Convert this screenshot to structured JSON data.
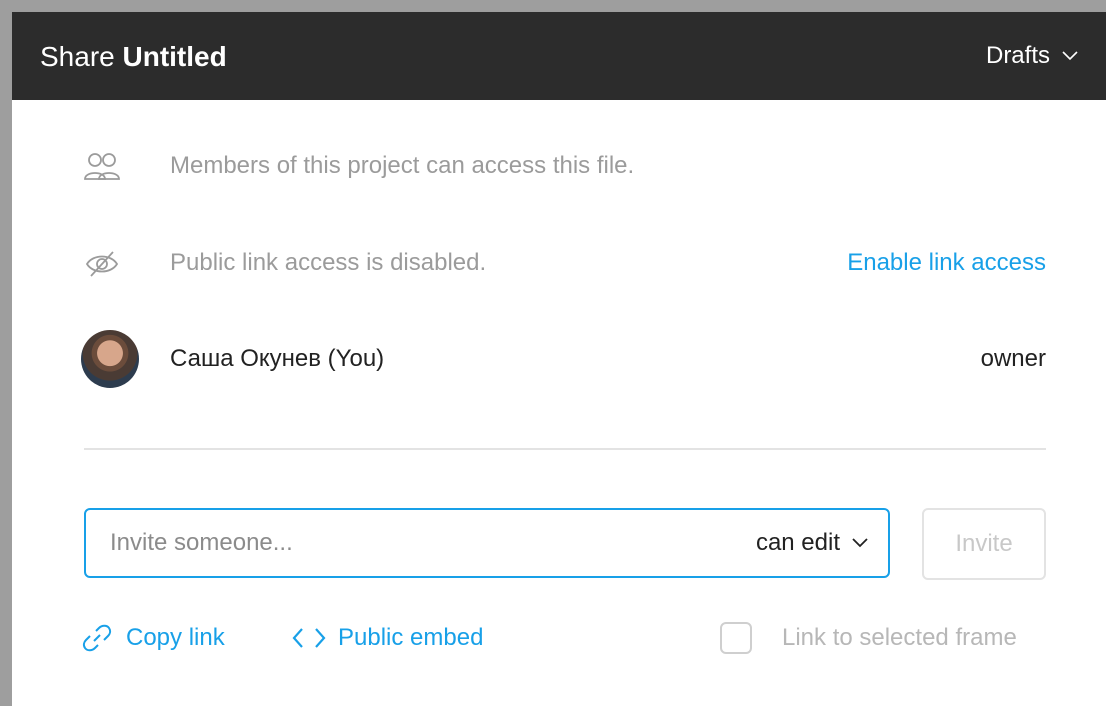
{
  "header": {
    "title_prefix": "Share",
    "file_name": "Untitled",
    "project": "Drafts"
  },
  "info": {
    "members_text": "Members of this project can access this file.",
    "link_status_text": "Public link access is disabled.",
    "enable_link_label": "Enable link access"
  },
  "member": {
    "name": "Саша Окунев (You)",
    "role": "owner"
  },
  "invite": {
    "placeholder": "Invite someone...",
    "permission": "can edit",
    "button_label": "Invite"
  },
  "footer": {
    "copy_link_label": "Copy link",
    "public_embed_label": "Public embed",
    "link_to_frame_label": "Link to selected frame",
    "link_to_frame_checked": false
  },
  "colors": {
    "accent": "#18a0e8",
    "header_bg": "#2c2c2c"
  }
}
